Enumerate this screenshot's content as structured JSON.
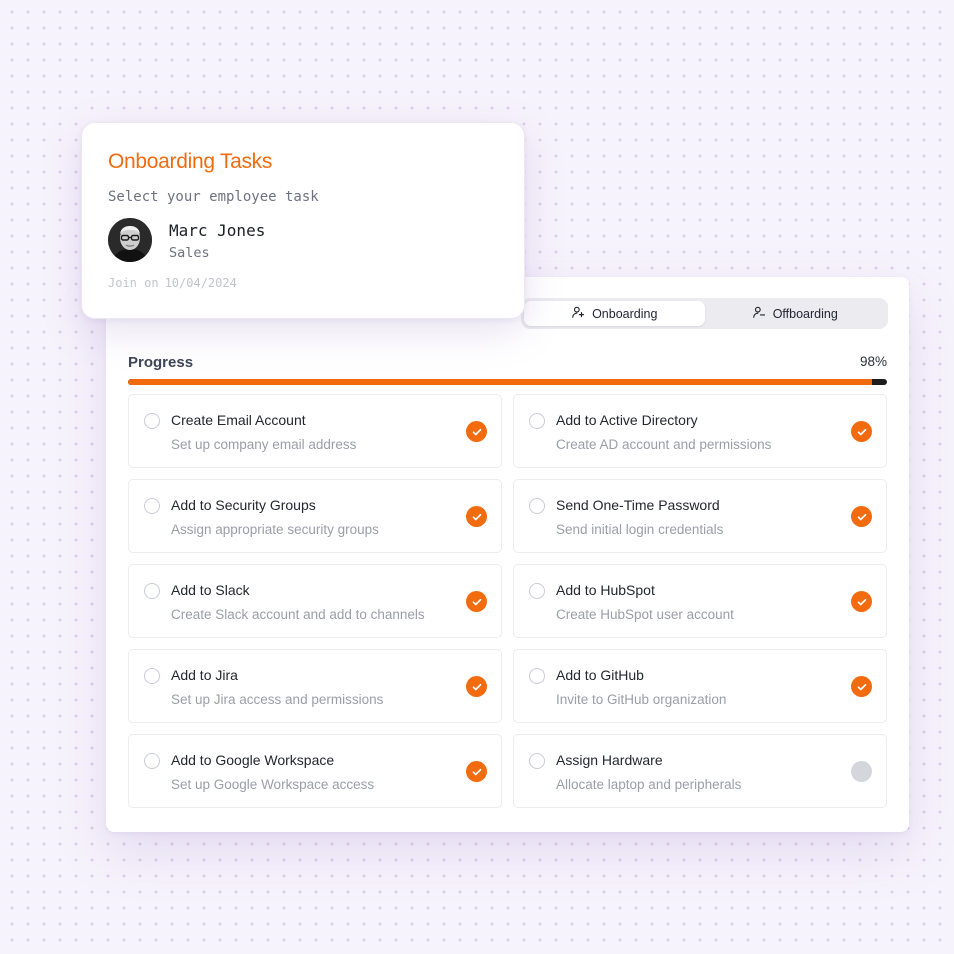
{
  "employee_card": {
    "title": "Onboarding Tasks",
    "subtitle": "Select your employee task",
    "name": "Marc Jones",
    "department": "Sales",
    "join_label": "Join on",
    "join_date": "10/04/2024"
  },
  "toggle": {
    "onboarding_label": "Onboarding",
    "offboarding_label": "Offboarding",
    "active": "onboarding"
  },
  "progress": {
    "label": "Progress",
    "value_text": "98%",
    "value": 0.98
  },
  "tasks": [
    {
      "title": "Create Email Account",
      "description": "Set up company email address",
      "done": true
    },
    {
      "title": "Add to Active Directory",
      "description": "Create AD account and permissions",
      "done": true
    },
    {
      "title": "Add to Security Groups",
      "description": "Assign appropriate security groups",
      "done": true
    },
    {
      "title": "Send One-Time Password",
      "description": "Send initial login credentials",
      "done": true
    },
    {
      "title": "Add to Slack",
      "description": "Create Slack account and add to channels",
      "done": true
    },
    {
      "title": "Add to HubSpot",
      "description": "Create HubSpot user account",
      "done": true
    },
    {
      "title": "Add to Jira",
      "description": "Set up Jira access and permissions",
      "done": true
    },
    {
      "title": "Add to GitHub",
      "description": "Invite to GitHub organization",
      "done": true
    },
    {
      "title": "Add to Google Workspace",
      "description": "Set up Google Workspace access",
      "done": true
    },
    {
      "title": "Assign Hardware",
      "description": "Allocate laptop and peripherals",
      "done": false
    }
  ],
  "icons": {
    "onboarding": "user-plus-icon",
    "offboarding": "user-minus-icon",
    "done": "check-icon",
    "pending": "pending-dot-icon"
  },
  "colors": {
    "accent": "#f26b0f",
    "pending": "#d5d6dc",
    "progress_track": "#1e1e1e"
  }
}
